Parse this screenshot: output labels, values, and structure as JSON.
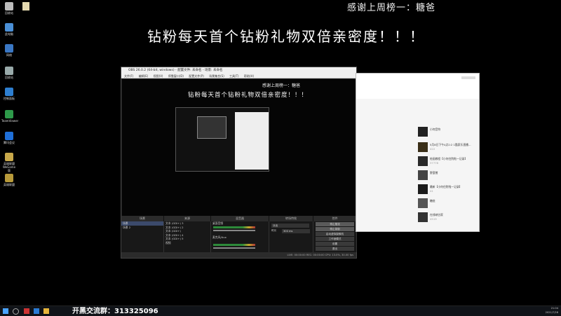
{
  "banner": {
    "top_text": "感谢上周榜一：糖爸",
    "main_text": "钻粉每天首个钻粉礼物双倍亲密度！！！"
  },
  "desktop_icons": [
    "回收站",
    "此电脑",
    "网络",
    "回收站",
    "控制面板",
    "TeamViewer",
    "腾讯会议",
    "英雄联盟",
    "WeGame版",
    "英雄联盟"
  ],
  "obs": {
    "title": "OBS 26.0.2 (64-bit, windows) - 配置文件: 未命名 - 场景: 未命名",
    "menu": [
      "文件(F)",
      "编辑(E)",
      "视图(V)",
      "停靠窗口(D)",
      "配置文件(P)",
      "场景集合(S)",
      "工具(T)",
      "帮助(H)"
    ],
    "preview_top": "感谢上周榜一：糖爸",
    "preview_main": "钻粉每天首个钻粉礼物双倍亲密度！！！",
    "panels": {
      "scenes_header": "场景",
      "sources_header": "来源",
      "mixer_header": "混音器",
      "transitions_header": "转场特效",
      "controls_header": "控件",
      "scenes": [
        "场景",
        "场景 2"
      ],
      "sources": [
        "文本 (GDI+) 3",
        "文本 (GDI+) 2",
        "文本 (GDI+)",
        "文本 (GDI+) 4",
        "文本 (GDI+) 5",
        "视频"
      ],
      "mixer": [
        "桌面音频",
        "麦克风/Aux"
      ],
      "transition_value": "淡出",
      "duration_label": "时长",
      "duration_value": "300 ms",
      "controls": [
        "停止推流",
        "停止录制",
        "启动虚拟摄像机",
        "工作室模式",
        "设置",
        "退出"
      ]
    },
    "status": "LIVE: 00:00:00   REC: 00:00:00   CPU: 13.0%, 30.00 fps"
  },
  "right_window": {
    "items": [
      {
        "title": "小何音符",
        "sub": ""
      },
      {
        "title": "5月8日下午4点2:2 1酷家乐直播...",
        "sub": "422"
      },
      {
        "title": "绘画教程【小何住院啦一记录】",
        "sub": "37778"
      },
      {
        "title": "野蛮猪",
        "sub": ""
      },
      {
        "title": "最新【小何住院啦一记录】",
        "sub": "41"
      },
      {
        "title": "糖爸",
        "sub": ""
      },
      {
        "title": "在线峡谷家",
        "sub": "4519"
      }
    ]
  },
  "taskbar": {
    "qq_group": "开黑交流群：313325096",
    "time": "21:04",
    "date": "2021/7/28"
  }
}
